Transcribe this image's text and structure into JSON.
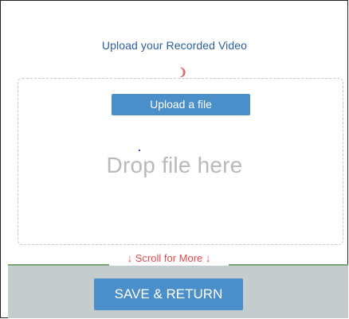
{
  "upload": {
    "title": "Upload your Recorded Video",
    "button_label": "Upload a file",
    "drop_text": "Drop file here"
  },
  "footer": {
    "scroll_hint": "↓ Scroll for More ↓",
    "save_label": "SAVE & RETURN"
  },
  "colors": {
    "title": "#2a5d9f",
    "button_bg": "#4a8fca",
    "footer_bg": "#c4cccd",
    "scroll_hint": "#e04a4a",
    "drop_text": "#b9b9b9"
  }
}
